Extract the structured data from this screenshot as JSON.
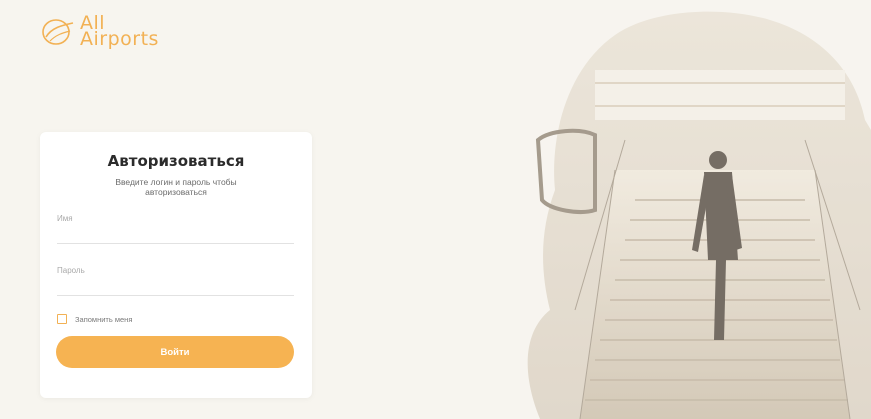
{
  "brand": {
    "line1": "All",
    "line2": "Airports"
  },
  "login": {
    "title": "Авторизоваться",
    "subtitle": "Введите логин и пароль чтобы авторизоваться",
    "name_placeholder": "Имя",
    "password_placeholder": "Пароль",
    "remember_label": "Запомнить меня",
    "submit_label": "Войти"
  },
  "colors": {
    "accent": "#f6b352",
    "background": "#f7f5ef",
    "card": "#ffffff"
  },
  "hero_image": {
    "icon": "man-stairs-double-exposure-image"
  }
}
